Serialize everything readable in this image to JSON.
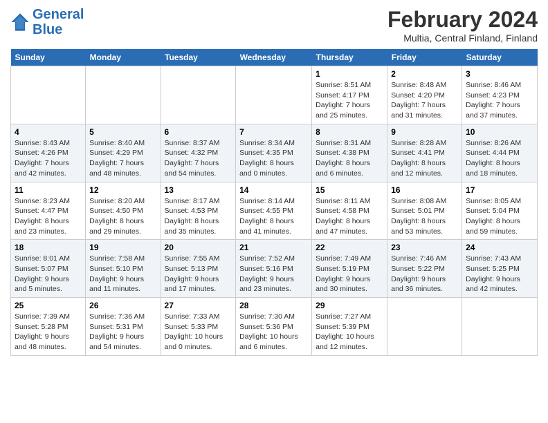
{
  "header": {
    "logo_line1": "General",
    "logo_line2": "Blue",
    "month_title": "February 2024",
    "location": "Multia, Central Finland, Finland"
  },
  "weekdays": [
    "Sunday",
    "Monday",
    "Tuesday",
    "Wednesday",
    "Thursday",
    "Friday",
    "Saturday"
  ],
  "weeks": [
    [
      {
        "day": "",
        "info": ""
      },
      {
        "day": "",
        "info": ""
      },
      {
        "day": "",
        "info": ""
      },
      {
        "day": "",
        "info": ""
      },
      {
        "day": "1",
        "info": "Sunrise: 8:51 AM\nSunset: 4:17 PM\nDaylight: 7 hours\nand 25 minutes."
      },
      {
        "day": "2",
        "info": "Sunrise: 8:48 AM\nSunset: 4:20 PM\nDaylight: 7 hours\nand 31 minutes."
      },
      {
        "day": "3",
        "info": "Sunrise: 8:46 AM\nSunset: 4:23 PM\nDaylight: 7 hours\nand 37 minutes."
      }
    ],
    [
      {
        "day": "4",
        "info": "Sunrise: 8:43 AM\nSunset: 4:26 PM\nDaylight: 7 hours\nand 42 minutes."
      },
      {
        "day": "5",
        "info": "Sunrise: 8:40 AM\nSunset: 4:29 PM\nDaylight: 7 hours\nand 48 minutes."
      },
      {
        "day": "6",
        "info": "Sunrise: 8:37 AM\nSunset: 4:32 PM\nDaylight: 7 hours\nand 54 minutes."
      },
      {
        "day": "7",
        "info": "Sunrise: 8:34 AM\nSunset: 4:35 PM\nDaylight: 8 hours\nand 0 minutes."
      },
      {
        "day": "8",
        "info": "Sunrise: 8:31 AM\nSunset: 4:38 PM\nDaylight: 8 hours\nand 6 minutes."
      },
      {
        "day": "9",
        "info": "Sunrise: 8:28 AM\nSunset: 4:41 PM\nDaylight: 8 hours\nand 12 minutes."
      },
      {
        "day": "10",
        "info": "Sunrise: 8:26 AM\nSunset: 4:44 PM\nDaylight: 8 hours\nand 18 minutes."
      }
    ],
    [
      {
        "day": "11",
        "info": "Sunrise: 8:23 AM\nSunset: 4:47 PM\nDaylight: 8 hours\nand 23 minutes."
      },
      {
        "day": "12",
        "info": "Sunrise: 8:20 AM\nSunset: 4:50 PM\nDaylight: 8 hours\nand 29 minutes."
      },
      {
        "day": "13",
        "info": "Sunrise: 8:17 AM\nSunset: 4:53 PM\nDaylight: 8 hours\nand 35 minutes."
      },
      {
        "day": "14",
        "info": "Sunrise: 8:14 AM\nSunset: 4:55 PM\nDaylight: 8 hours\nand 41 minutes."
      },
      {
        "day": "15",
        "info": "Sunrise: 8:11 AM\nSunset: 4:58 PM\nDaylight: 8 hours\nand 47 minutes."
      },
      {
        "day": "16",
        "info": "Sunrise: 8:08 AM\nSunset: 5:01 PM\nDaylight: 8 hours\nand 53 minutes."
      },
      {
        "day": "17",
        "info": "Sunrise: 8:05 AM\nSunset: 5:04 PM\nDaylight: 8 hours\nand 59 minutes."
      }
    ],
    [
      {
        "day": "18",
        "info": "Sunrise: 8:01 AM\nSunset: 5:07 PM\nDaylight: 9 hours\nand 5 minutes."
      },
      {
        "day": "19",
        "info": "Sunrise: 7:58 AM\nSunset: 5:10 PM\nDaylight: 9 hours\nand 11 minutes."
      },
      {
        "day": "20",
        "info": "Sunrise: 7:55 AM\nSunset: 5:13 PM\nDaylight: 9 hours\nand 17 minutes."
      },
      {
        "day": "21",
        "info": "Sunrise: 7:52 AM\nSunset: 5:16 PM\nDaylight: 9 hours\nand 23 minutes."
      },
      {
        "day": "22",
        "info": "Sunrise: 7:49 AM\nSunset: 5:19 PM\nDaylight: 9 hours\nand 30 minutes."
      },
      {
        "day": "23",
        "info": "Sunrise: 7:46 AM\nSunset: 5:22 PM\nDaylight: 9 hours\nand 36 minutes."
      },
      {
        "day": "24",
        "info": "Sunrise: 7:43 AM\nSunset: 5:25 PM\nDaylight: 9 hours\nand 42 minutes."
      }
    ],
    [
      {
        "day": "25",
        "info": "Sunrise: 7:39 AM\nSunset: 5:28 PM\nDaylight: 9 hours\nand 48 minutes."
      },
      {
        "day": "26",
        "info": "Sunrise: 7:36 AM\nSunset: 5:31 PM\nDaylight: 9 hours\nand 54 minutes."
      },
      {
        "day": "27",
        "info": "Sunrise: 7:33 AM\nSunset: 5:33 PM\nDaylight: 10 hours\nand 0 minutes."
      },
      {
        "day": "28",
        "info": "Sunrise: 7:30 AM\nSunset: 5:36 PM\nDaylight: 10 hours\nand 6 minutes."
      },
      {
        "day": "29",
        "info": "Sunrise: 7:27 AM\nSunset: 5:39 PM\nDaylight: 10 hours\nand 12 minutes."
      },
      {
        "day": "",
        "info": ""
      },
      {
        "day": "",
        "info": ""
      }
    ]
  ]
}
